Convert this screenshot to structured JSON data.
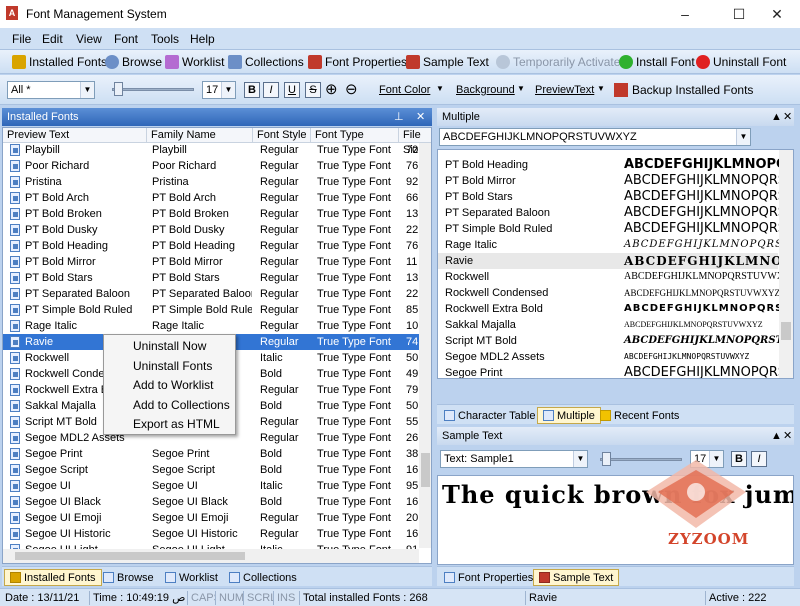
{
  "window": {
    "title": "Font Management System",
    "minimize": "–",
    "maximize": "☐",
    "close": "✕"
  },
  "menu": [
    "File",
    "Edit",
    "View",
    "Font",
    "Tools",
    "Help"
  ],
  "toolbar": [
    {
      "label": "Installed Fonts",
      "icon": "warning-font-icon",
      "color": "#d9a400"
    },
    {
      "label": "Browse",
      "icon": "magnifier-icon",
      "color": "#6c8fc7"
    },
    {
      "label": "Worklist",
      "icon": "checklist-icon",
      "color": "#b46bd1"
    },
    {
      "label": "Collections",
      "icon": "collections-icon",
      "color": "#6c8fc7"
    },
    {
      "label": "Font Properties",
      "icon": "font-properties-icon",
      "color": "#c0392b"
    },
    {
      "label": "Sample Text",
      "icon": "sample-text-icon",
      "color": "#c0392b"
    },
    {
      "label": "Temporarily Activate",
      "icon": "temp-activate-icon",
      "color": "#9ab",
      "disabled": true
    },
    {
      "label": "Install Font",
      "icon": "green-circle-icon",
      "color": "#2fb12f"
    },
    {
      "label": "Uninstall Font",
      "icon": "red-circle-icon",
      "color": "#e02020"
    }
  ],
  "format_bar": {
    "filter_value": "All *",
    "size_value": "17",
    "bold": "B",
    "italic": "I",
    "underline": "U",
    "strike": "S",
    "zoom_in": "⊕",
    "zoom_out": "⊖",
    "font_color": "Font Color",
    "background": "Background",
    "preview_text": "PreviewText",
    "backup": "Backup Installed Fonts"
  },
  "installed_panel": {
    "title": "Installed Fonts",
    "columns": [
      "Preview Text",
      "Family Name",
      "Font Style",
      "Font Type",
      "File Siz"
    ],
    "rows": [
      [
        "Playbill",
        "Playbill",
        "Regular",
        "True Type Font",
        "70"
      ],
      [
        "Poor Richard",
        "Poor Richard",
        "Regular",
        "True Type Font",
        "76"
      ],
      [
        "Pristina",
        "Pristina",
        "Regular",
        "True Type Font",
        "92"
      ],
      [
        "PT Bold Arch",
        "PT Bold Arch",
        "Regular",
        "True Type Font",
        "66"
      ],
      [
        "PT Bold Broken",
        "PT Bold Broken",
        "Regular",
        "True Type Font",
        "13"
      ],
      [
        "PT Bold Dusky",
        "PT Bold Dusky",
        "Regular",
        "True Type Font",
        "22"
      ],
      [
        "PT Bold Heading",
        "PT Bold Heading",
        "Regular",
        "True Type Font",
        "76"
      ],
      [
        "PT Bold Mirror",
        "PT Bold Mirror",
        "Regular",
        "True Type Font",
        "11"
      ],
      [
        "PT Bold Stars",
        "PT Bold Stars",
        "Regular",
        "True Type Font",
        "13"
      ],
      [
        "PT Separated Baloon",
        "PT Separated Baloon",
        "Regular",
        "True Type Font",
        "22"
      ],
      [
        "PT Simple Bold Ruled",
        "PT Simple Bold Ruled",
        "Regular",
        "True Type Font",
        "85"
      ],
      [
        "Rage Italic",
        "Rage Italic",
        "Regular",
        "True Type Font",
        "10"
      ],
      [
        "Ravie",
        "",
        "Regular",
        "True Type Font",
        "74"
      ],
      [
        "Rockwell",
        "",
        "Italic",
        "True Type Font",
        "50"
      ],
      [
        "Rockwell Condensed",
        "",
        "Bold",
        "True Type Font",
        "49"
      ],
      [
        "Rockwell Extra Bold",
        "",
        "Regular",
        "True Type Font",
        "79"
      ],
      [
        "Sakkal Majalla",
        "",
        "Bold",
        "True Type Font",
        "50"
      ],
      [
        "Script MT Bold",
        "",
        "Regular",
        "True Type Font",
        "55"
      ],
      [
        "Segoe MDL2 Assets",
        "",
        "Regular",
        "True Type Font",
        "26"
      ],
      [
        "Segoe Print",
        "Segoe Print",
        "Bold",
        "True Type Font",
        "38"
      ],
      [
        "Segoe Script",
        "Segoe Script",
        "Bold",
        "True Type Font",
        "16"
      ],
      [
        "Segoe UI",
        "Segoe UI",
        "Italic",
        "True Type Font",
        "95"
      ],
      [
        "Segoe UI Black",
        "Segoe UI Black",
        "Bold",
        "True Type Font",
        "16"
      ],
      [
        "Segoe UI Emoji",
        "Segoe UI Emoji",
        "Regular",
        "True Type Font",
        "20"
      ],
      [
        "Segoe UI Historic",
        "Segoe UI Historic",
        "Regular",
        "True Type Font",
        "16"
      ],
      [
        "Segoe UI Light",
        "Segoe UI Light",
        "Italic",
        "True Type Font",
        "91"
      ]
    ],
    "selected_index": 12
  },
  "context_menu": [
    "Uninstall Now",
    "Uninstall Fonts",
    "Add to Worklist",
    "Add to Collections",
    "Export as HTML"
  ],
  "left_tabs": [
    "Installed Fonts",
    "Browse",
    "Worklist",
    "Collections"
  ],
  "multiple_panel": {
    "title": "Multiple",
    "preview_value": "ABCDEFGHIJKLMNOPQRSTUVWXYZ",
    "rows": [
      [
        "PT Bold Heading",
        "ABCDEFGHIJKLMNOPQRS"
      ],
      [
        "PT Bold Mirror",
        "ABCDEFGHIJKLMNOPQRS"
      ],
      [
        "PT Bold Stars",
        "ABCDEFGHIJKLMNOPQRS"
      ],
      [
        "PT Separated Baloon",
        "ABCDEFGHIJKLMNOPQRS"
      ],
      [
        "PT Simple Bold Ruled",
        "ABCDEFGHIJKLMNOPQRS"
      ],
      [
        "Rage Italic",
        "ABCDEFGHIJKLMNOPQRSTUVWX"
      ],
      [
        "Ravie",
        "ABCDEFGHIJKLMNOPQ"
      ],
      [
        "Rockwell",
        "ABCDEFGHIJKLMNOPQRSTUVWX"
      ],
      [
        "Rockwell Condensed",
        "ABCDEFGHIJKLMNOPQRSTUVWXYZ"
      ],
      [
        "Rockwell Extra Bold",
        "ABCDEFGHIJKLMNOPQRST"
      ],
      [
        "Sakkal Majalla",
        "ABCDEFGHIJKLMNOPQRSTUVWXYZ"
      ],
      [
        "Script MT Bold",
        "ABCDEFGHIJKLMNOPQRSTU"
      ],
      [
        "Segoe MDL2 Assets",
        "ABCDEFGHIJKLMNOPQRSTUVWXYZ"
      ],
      [
        "Segoe Print",
        "ABCDEFGHIJKLMNOPQRS"
      ]
    ],
    "selected_index": 6
  },
  "right_tabs_top": [
    "Character Table",
    "Multiple",
    "Recent Fonts"
  ],
  "sample_panel": {
    "title": "Sample Text",
    "combo_value": "Text: Sample1",
    "size_value": "17",
    "bold": "B",
    "italic": "I",
    "text": "The quick brown fox jum"
  },
  "right_tabs_bottom": [
    "Font Properties",
    "Sample Text"
  ],
  "watermark": "ZYZOOM",
  "status": {
    "date": "Date : 13/11/21",
    "time": "Time : 10:49:19 ص",
    "caps": "CAPS",
    "num": "NUM",
    "scrl": "SCRL",
    "ins": "INS",
    "total": "Total installed Fonts : 268",
    "current": "Ravie",
    "active": "Active : 222"
  }
}
